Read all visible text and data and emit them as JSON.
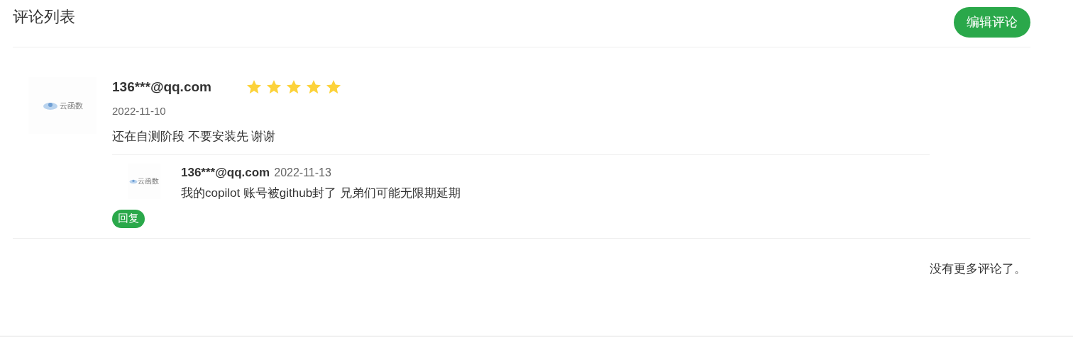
{
  "header": {
    "title": "评论列表",
    "edit_button": "编辑评论"
  },
  "comments": [
    {
      "avatar_text": "云函数",
      "author": "136***@qq.com",
      "stars": 5,
      "date": "2022-11-10",
      "content": "还在自测阶段 不要安装先 谢谢",
      "replies": [
        {
          "avatar_text": "云函数",
          "author": "136***@qq.com",
          "date": "2022-11-13",
          "content": "我的copilot 账号被github封了 兄弟们可能无限期延期"
        }
      ],
      "reply_button": "回复"
    }
  ],
  "footer": {
    "end_text": "没有更多评论了。"
  }
}
